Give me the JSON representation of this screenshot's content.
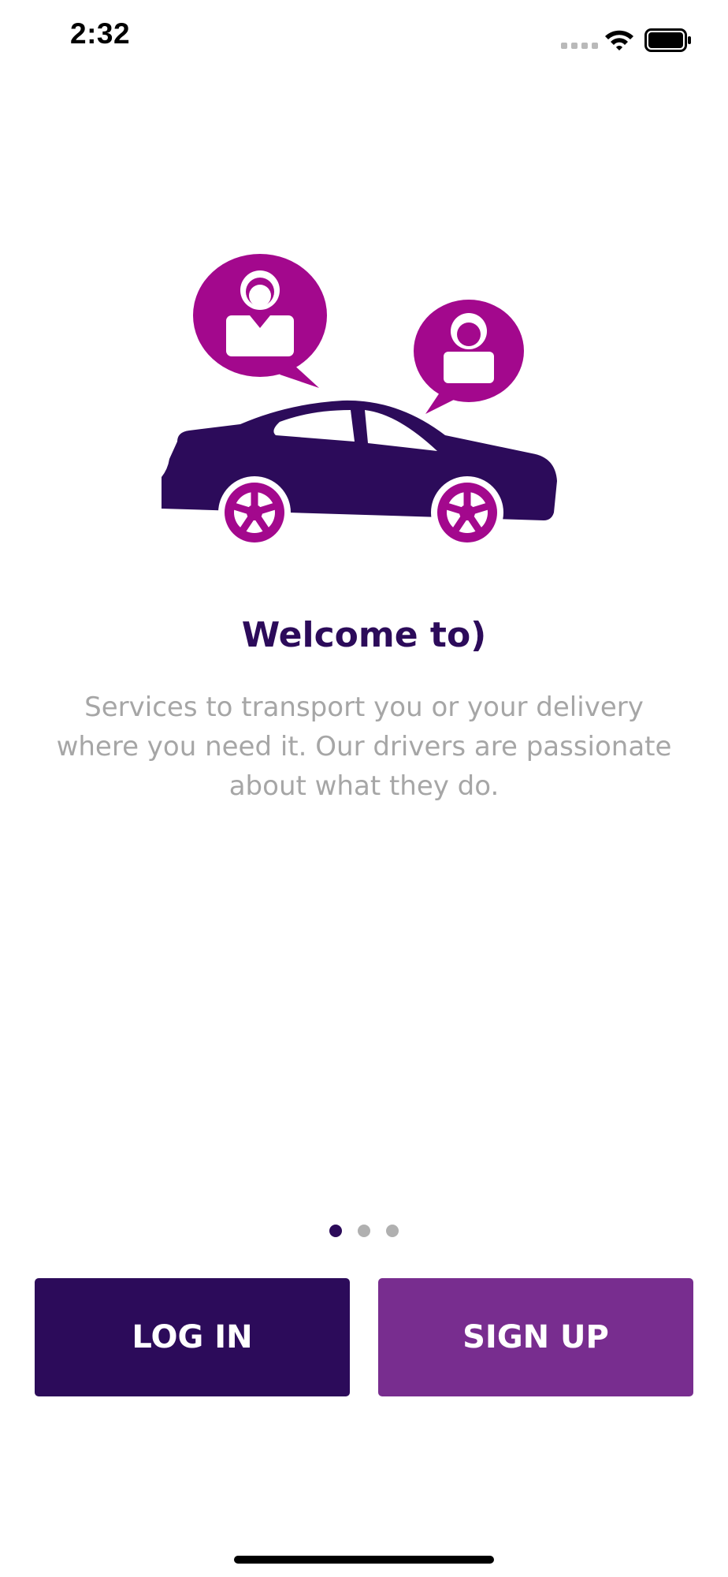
{
  "status_bar": {
    "time": "2:32",
    "icons": [
      "signal-dots-icon",
      "wifi-icon",
      "battery-icon"
    ]
  },
  "hero": {
    "icon": "car-with-chat-bubbles-illustration",
    "colors": {
      "car": "#2c0b5a",
      "accent": "#a3088d"
    }
  },
  "onboarding": {
    "title": "Welcome to)",
    "description": "Services to transport you or your delivery where you need it. Our drivers are passionate about what they do.",
    "page_current": 1,
    "page_total": 3
  },
  "actions": {
    "login_label": "LOG IN",
    "signup_label": "SIGN UP"
  },
  "theme": {
    "primary": "#2c0b5a",
    "secondary": "#782d8f",
    "muted_text": "#a6a6a6"
  }
}
